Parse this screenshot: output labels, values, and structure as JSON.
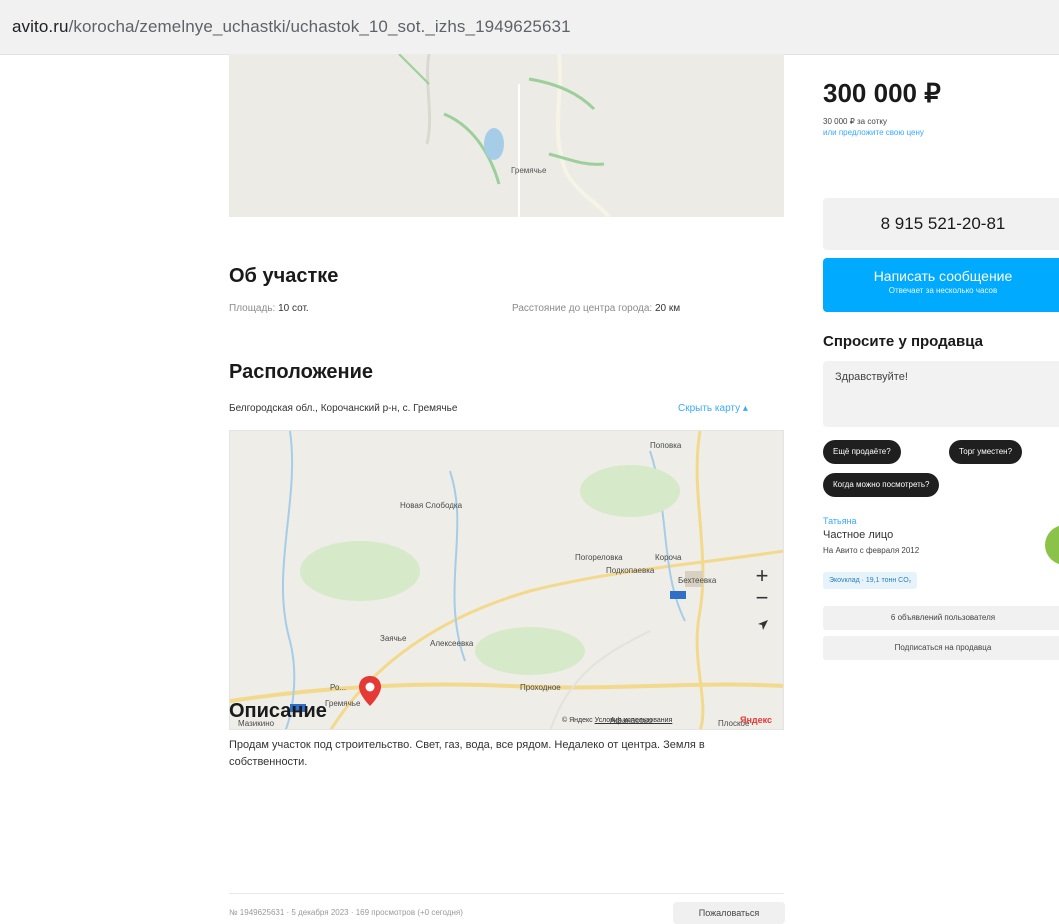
{
  "browser": {
    "url_domain": "avito.ru",
    "url_path": "/korocha/zemelnye_uchastki/uchastok_10_sot._izhs_1949625631"
  },
  "top_map": {
    "label": "Гремячье"
  },
  "about": {
    "title": "Об участке",
    "area_label": "Площадь:",
    "area_value": "10 сот.",
    "distance_label": "Расстояние до центра города:",
    "distance_value": "20 км"
  },
  "location": {
    "title": "Расположение",
    "address": "Белгородская обл., Корочанский р-н, с. Гремячье",
    "hide_map": "Скрыть карту",
    "map_labels": {
      "l1": "Поповка",
      "l2": "Новая Слободка",
      "l3": "Погореловка",
      "l4": "Короча",
      "l5": "Подкопаевка",
      "l6": "Бехтеевка",
      "l7": "Заячье",
      "l8": "Алексеевка",
      "l9": "Гремячье",
      "l10": "Проходное",
      "l11": "Афанасово",
      "l12": "Мазикино",
      "l13": "Плоское",
      "l14": "Ро..."
    },
    "copyright": "© Яндекс",
    "terms": "Условия использования",
    "brand": "Яндекс",
    "zoom_in": "+",
    "zoom_out": "−"
  },
  "description": {
    "title": "Описание",
    "text": "Продам участок под строительство. Свет, газ, вода, все рядом. Недалеко от центра. Земля в собственности."
  },
  "footer": {
    "meta": "№ 1949625631 · 5 декабря 2023 · 169 просмотров (+0 сегодня)",
    "complain": "Пожаловаться"
  },
  "sidebar": {
    "price": "300 000 ₽",
    "price_per": "30 000 ₽ за сотку",
    "price_offer": "или предложите свою цену",
    "phone": "8 915 521-20-81",
    "message_button": "Написать сообщение",
    "message_sub": "Отвечает за несколько часов",
    "ask_title": "Спросите у продавца",
    "ask_placeholder": "Здравствуйте!",
    "chips": [
      "Ещё продаёте?",
      "Торг уместен?",
      "Когда можно посмотреть?"
    ],
    "seller_name": "Татьяна",
    "seller_type": "Частное лицо",
    "seller_since": "На Авито с февраля 2012",
    "eco": "Экovклад · 19,1 тонн CO₂",
    "ads_button": "6 объявлений пользователя",
    "subscribe_button": "Подписаться на продавца"
  }
}
